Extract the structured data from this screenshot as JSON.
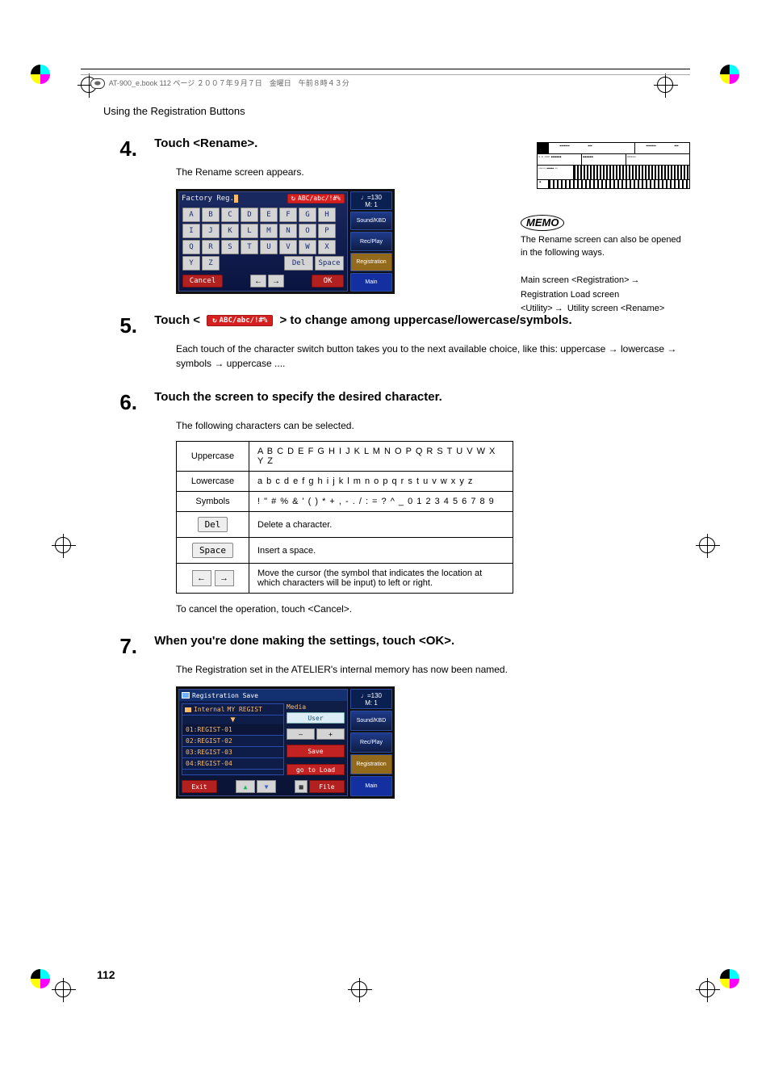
{
  "header": {
    "book_ref": "AT-900_e.book  112 ページ  ２００７年９月７日　金曜日　午前８時４３分"
  },
  "section_title": "Using the Registration Buttons",
  "memo": {
    "label": "MEMO",
    "text": "The Rename screen can also be opened in the following ways.",
    "path1a": "Main screen <Registration>",
    "path1b": "Registration Load screen",
    "path2a": "<Utility>",
    "path2b": "Utility screen <Rename>",
    "arrow": "→"
  },
  "step4": {
    "num": "4.",
    "heading": "Touch <Rename>.",
    "body": "The Rename screen appears."
  },
  "rename_screen": {
    "title": "Factory Reg.",
    "switch_label": "ABC/abc/!#%",
    "tempo_top": "♩=130",
    "tempo_bottom": "M:   1",
    "side": [
      "Sound/KBD",
      "Rec/Play",
      "Registration",
      "Main"
    ],
    "rows": [
      [
        "A",
        "B",
        "C",
        "D",
        "E",
        "F",
        "G",
        "H"
      ],
      [
        "I",
        "J",
        "K",
        "L",
        "M",
        "N",
        "O",
        "P"
      ],
      [
        "Q",
        "R",
        "S",
        "T",
        "U",
        "V",
        "W",
        "X"
      ]
    ],
    "y": "Y",
    "z": "Z",
    "del": "Del",
    "space": "Space",
    "cancel": "Cancel",
    "left": "←",
    "right": "→",
    "ok": "OK"
  },
  "step5": {
    "num": "5.",
    "heading_a": "Touch <",
    "heading_b": "> to change among uppercase/lowercase/symbols.",
    "body": "Each touch of the character switch button takes you to the next available choice, like this: uppercase → lowercase → symbols → uppercase ...."
  },
  "step6": {
    "num": "6.",
    "heading": "Touch the screen to specify the desired character.",
    "body": "The following characters can be selected."
  },
  "char_table": {
    "rows": [
      {
        "label": "Uppercase",
        "chars": "A B C D E F G H I J K L M N O P Q R S T U V W X Y Z"
      },
      {
        "label": "Lowercase",
        "chars": "a b c d e f g h i j k l m n o p q r s t u v w x y z"
      },
      {
        "label": "Symbols",
        "chars": "! \" # % & ' ( ) * + , - . / : = ? ^ _ 0 1 2 3 4 5 6 7 8 9"
      }
    ],
    "del_key": "Del",
    "del_desc": "Delete a character.",
    "space_key": "Space",
    "space_desc": "Insert a space.",
    "arrow_desc": "Move the cursor (the symbol that indicates the location at which characters will be input) to left or right."
  },
  "cancel_note": "To cancel the operation, touch <Cancel>.",
  "step7": {
    "num": "7.",
    "heading": "When you're done making the settings, touch <OK>.",
    "body": "The Registration set in the ATELIER's internal memory has now been named."
  },
  "save_screen": {
    "title": "Registration Save",
    "internal": "Internal",
    "name": "MY REGIST",
    "items": [
      "01:REGIST-01",
      "02:REGIST-02",
      "03:REGIST-03",
      "04:REGIST-04"
    ],
    "media": "Media",
    "user": "User",
    "save": "Save",
    "goto_load": "go to Load",
    "exit": "Exit",
    "file": "File",
    "tri_up": "▲",
    "tri_dn": "▼",
    "minus": "—",
    "plus": "+",
    "tempo_top": "♩=130",
    "tempo_bottom": "M:   1",
    "side": [
      "Sound/KBD",
      "Rec/Play",
      "Registration",
      "Main"
    ]
  },
  "page_number": "112"
}
